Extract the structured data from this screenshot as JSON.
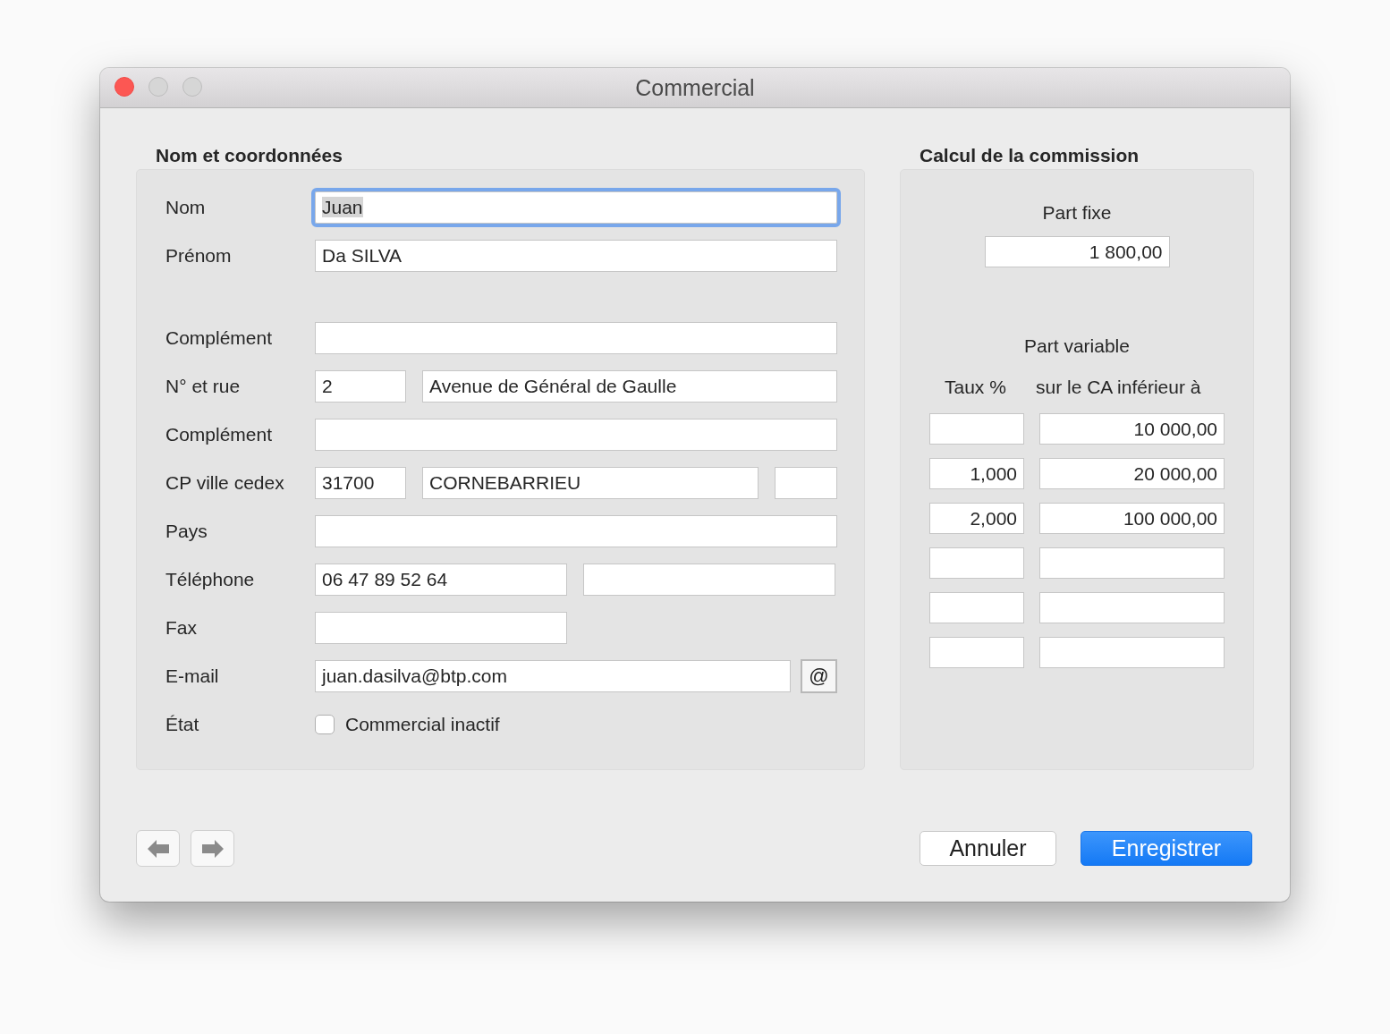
{
  "window": {
    "title": "Commercial"
  },
  "contact": {
    "title": "Nom et coordonnées",
    "groups": [
      [
        {
          "label": "Nom",
          "kind": "full",
          "fields": [
            {
              "value": "Juan",
              "focused": true
            }
          ]
        },
        {
          "label": "Prénom",
          "kind": "full",
          "fields": [
            {
              "value": "Da SILVA",
              "focused": false
            }
          ]
        }
      ],
      [
        {
          "label": "Complément",
          "kind": "full",
          "fields": [
            {
              "focused": false
            }
          ]
        },
        {
          "label": "N° et rue",
          "kind": "street",
          "fields": [
            {
              "value": "2",
              "focused": false
            },
            {
              "value": "Avenue de Général de Gaulle",
              "focused": false
            }
          ]
        },
        {
          "label": "Complément",
          "kind": "full",
          "fields": [
            {
              "focused": false
            }
          ]
        },
        {
          "label": "CP ville cedex",
          "kind": "city",
          "fields": [
            {
              "value": "31700",
              "focused": false
            },
            {
              "value": "CORNEBARRIEU",
              "focused": false
            },
            {
              "focused": false
            }
          ]
        },
        {
          "label": "Pays",
          "kind": "full",
          "fields": [
            {
              "focused": false
            }
          ]
        },
        {
          "label": "Téléphone",
          "kind": "phone",
          "fields": [
            {
              "value": "06 47 89 52 64",
              "focused": false
            },
            {
              "focused": false
            }
          ]
        },
        {
          "label": "Fax",
          "kind": "short",
          "fields": [
            {
              "focused": false
            }
          ]
        },
        {
          "label": "E-mail",
          "kind": "email",
          "fields": [
            {
              "value": "juan.dasilva@btp.com",
              "focused": false
            }
          ],
          "button": "@"
        },
        {
          "label": "État",
          "kind": "checkbox",
          "option": "Commercial inactif",
          "checked": false
        }
      ]
    ]
  },
  "commission": {
    "title": "Calcul de la commission",
    "fixed_label": "Part fixe",
    "fixed_value": "1 800,00",
    "variable_label": "Part variable",
    "columns": [
      "Taux %",
      "sur le CA inférieur à"
    ],
    "rows": [
      {
        "ceiling": "10 000,00"
      },
      {
        "rate": "1,000",
        "ceiling": "20 000,00"
      },
      {
        "rate": "2,000",
        "ceiling": "100 000,00"
      },
      {},
      {},
      {}
    ]
  },
  "buttons": {
    "cancel": "Annuler",
    "save": "Enregistrer"
  }
}
